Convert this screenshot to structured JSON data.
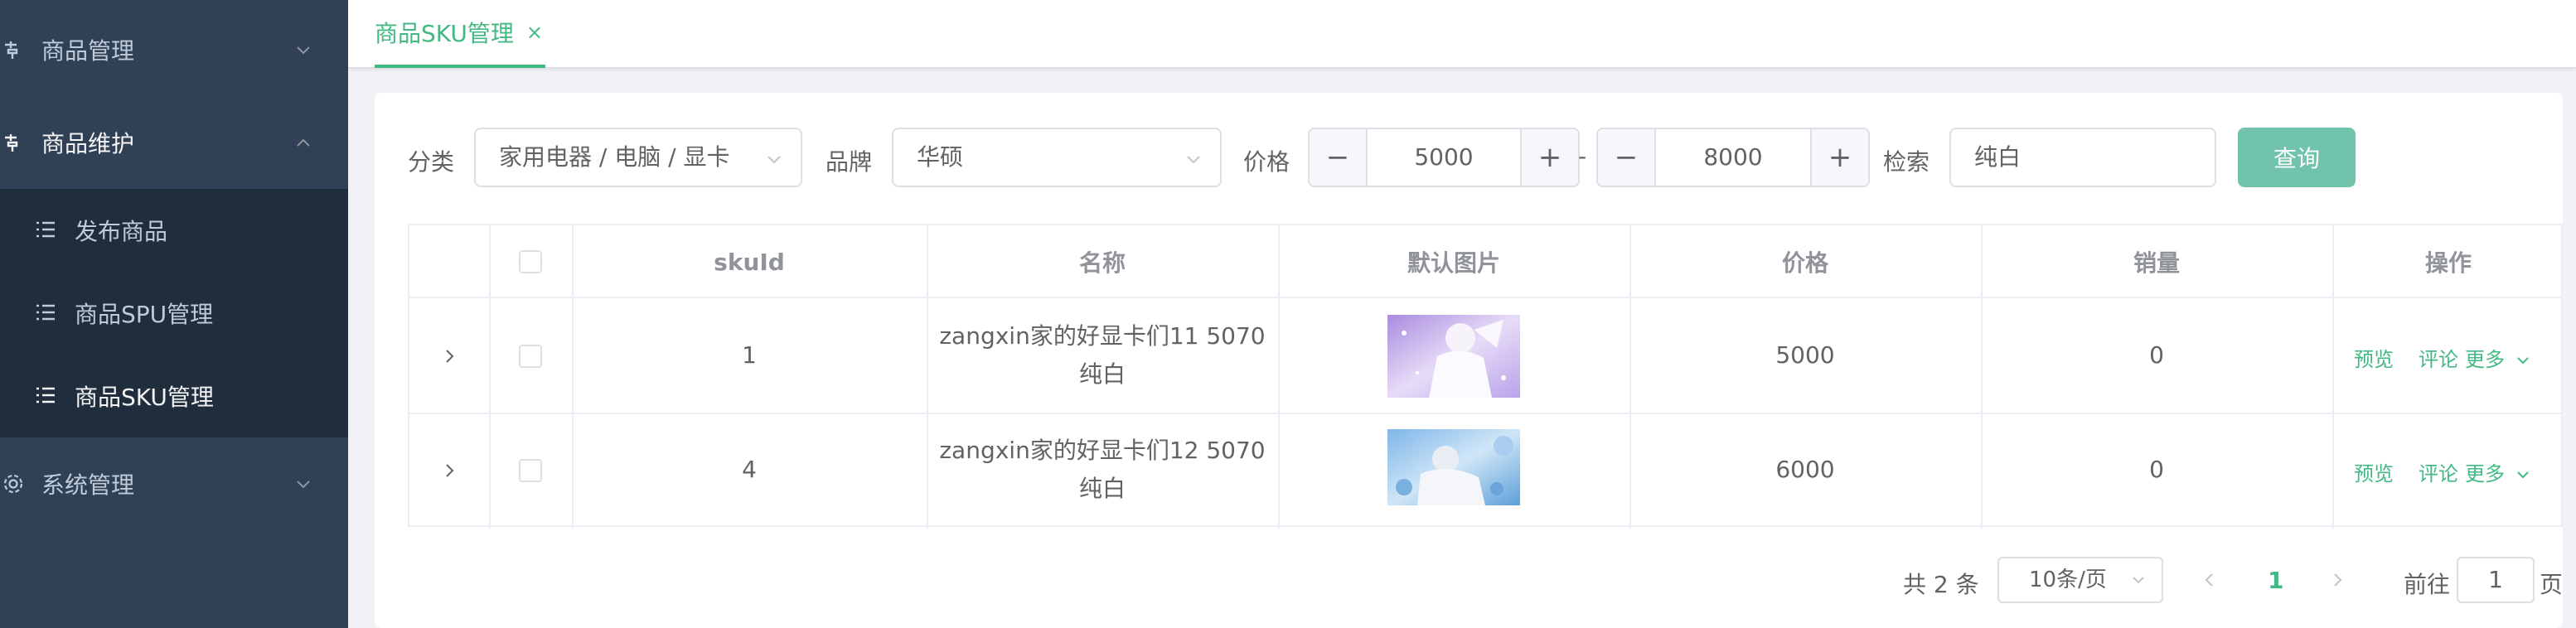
{
  "sidebar": {
    "items": [
      {
        "label": "商品管理",
        "icon": "tools-icon",
        "expanded": false
      },
      {
        "label": "商品维护",
        "icon": "tools-icon",
        "expanded": true
      },
      {
        "label": "系统管理",
        "icon": "gear-icon",
        "expanded": false
      }
    ],
    "sub_items": [
      {
        "label": "发布商品",
        "icon": "list-icon"
      },
      {
        "label": "商品SPU管理",
        "icon": "list-icon"
      },
      {
        "label": "商品SKU管理",
        "icon": "list-icon",
        "active": true
      }
    ]
  },
  "tabs": [
    {
      "label": "商品SKU管理",
      "close": "×"
    }
  ],
  "filters": {
    "category_label": "分类",
    "category_value": "家用电器 / 电脑 / 显卡",
    "brand_label": "品牌",
    "brand_value": "华硕",
    "price_label": "价格",
    "price_min": "5000",
    "price_max": "8000",
    "price_separator": "-",
    "search_label": "检索",
    "search_value": "纯白",
    "query_button": "查询"
  },
  "table": {
    "headers": [
      "skuId",
      "名称",
      "默认图片",
      "价格",
      "销量",
      "操作"
    ],
    "rows": [
      {
        "skuId": "1",
        "name_line1": "zangxin家的好显卡们11 5070",
        "name_line2": "纯白",
        "price": "5000",
        "sales": "0"
      },
      {
        "skuId": "4",
        "name_line1": "zangxin家的好显卡们12 5070",
        "name_line2": "纯白",
        "price": "6000",
        "sales": "0"
      }
    ],
    "actions": {
      "preview": "预览",
      "comment": "评论",
      "more": "更多"
    }
  },
  "pagination": {
    "total": "共 2 条",
    "page_size": "10条/页",
    "current_page": "1",
    "goto_label": "前往",
    "goto_value": "1",
    "page_suffix": "页"
  },
  "colors": {
    "sidebar_bg": "#304156",
    "submenu_bg": "#1f2d3d",
    "accent": "#42b983",
    "query_button": "#71c4ab"
  }
}
